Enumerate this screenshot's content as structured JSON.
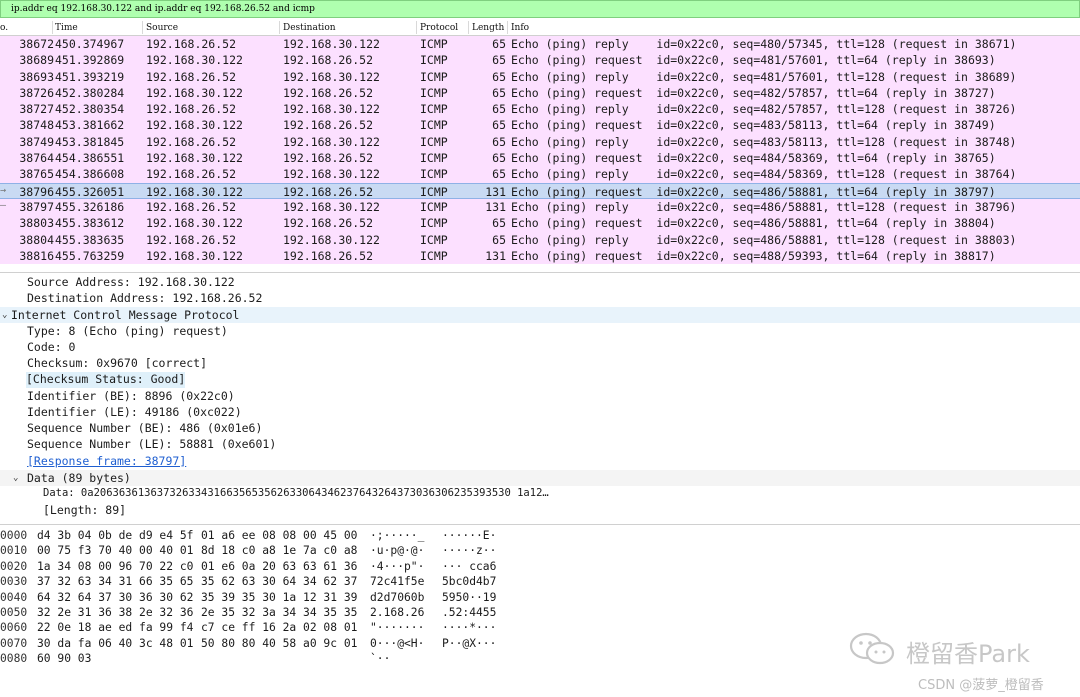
{
  "filter": {
    "text": "ip.addr eq 192.168.30.122 and ip.addr eq 192.168.26.52 and icmp"
  },
  "columns": [
    "o.",
    "Time",
    "Source",
    "Destination",
    "Protocol",
    "Length",
    "Info"
  ],
  "packets": [
    {
      "mark": "",
      "no": "38672",
      "time": "450.374967",
      "src": "192.168.26.52",
      "dst": "192.168.30.122",
      "proto": "ICMP",
      "len": "65",
      "info": "Echo (ping) reply    id=0x22c0, seq=480/57345, ttl=128 (request in 38671)",
      "selected": false
    },
    {
      "mark": "",
      "no": "38689",
      "time": "451.392869",
      "src": "192.168.30.122",
      "dst": "192.168.26.52",
      "proto": "ICMP",
      "len": "65",
      "info": "Echo (ping) request  id=0x22c0, seq=481/57601, ttl=64 (reply in 38693)",
      "selected": false
    },
    {
      "mark": "",
      "no": "38693",
      "time": "451.393219",
      "src": "192.168.26.52",
      "dst": "192.168.30.122",
      "proto": "ICMP",
      "len": "65",
      "info": "Echo (ping) reply    id=0x22c0, seq=481/57601, ttl=128 (request in 38689)",
      "selected": false
    },
    {
      "mark": "",
      "no": "38726",
      "time": "452.380284",
      "src": "192.168.30.122",
      "dst": "192.168.26.52",
      "proto": "ICMP",
      "len": "65",
      "info": "Echo (ping) request  id=0x22c0, seq=482/57857, ttl=64 (reply in 38727)",
      "selected": false
    },
    {
      "mark": "",
      "no": "38727",
      "time": "452.380354",
      "src": "192.168.26.52",
      "dst": "192.168.30.122",
      "proto": "ICMP",
      "len": "65",
      "info": "Echo (ping) reply    id=0x22c0, seq=482/57857, ttl=128 (request in 38726)",
      "selected": false
    },
    {
      "mark": "",
      "no": "38748",
      "time": "453.381662",
      "src": "192.168.30.122",
      "dst": "192.168.26.52",
      "proto": "ICMP",
      "len": "65",
      "info": "Echo (ping) request  id=0x22c0, seq=483/58113, ttl=64 (reply in 38749)",
      "selected": false
    },
    {
      "mark": "",
      "no": "38749",
      "time": "453.381845",
      "src": "192.168.26.52",
      "dst": "192.168.30.122",
      "proto": "ICMP",
      "len": "65",
      "info": "Echo (ping) reply    id=0x22c0, seq=483/58113, ttl=128 (request in 38748)",
      "selected": false
    },
    {
      "mark": "",
      "no": "38764",
      "time": "454.386551",
      "src": "192.168.30.122",
      "dst": "192.168.26.52",
      "proto": "ICMP",
      "len": "65",
      "info": "Echo (ping) request  id=0x22c0, seq=484/58369, ttl=64 (reply in 38765)",
      "selected": false
    },
    {
      "mark": "",
      "no": "38765",
      "time": "454.386608",
      "src": "192.168.26.52",
      "dst": "192.168.30.122",
      "proto": "ICMP",
      "len": "65",
      "info": "Echo (ping) reply    id=0x22c0, seq=484/58369, ttl=128 (request in 38764)",
      "selected": false
    },
    {
      "mark": "→",
      "no": "38796",
      "time": "455.326051",
      "src": "192.168.30.122",
      "dst": "192.168.26.52",
      "proto": "ICMP",
      "len": "131",
      "info": "Echo (ping) request  id=0x22c0, seq=486/58881, ttl=64 (reply in 38797)",
      "selected": true
    },
    {
      "mark": "—",
      "no": "38797",
      "time": "455.326186",
      "src": "192.168.26.52",
      "dst": "192.168.30.122",
      "proto": "ICMP",
      "len": "131",
      "info": "Echo (ping) reply    id=0x22c0, seq=486/58881, ttl=128 (request in 38796)",
      "selected": false
    },
    {
      "mark": "",
      "no": "38803",
      "time": "455.383612",
      "src": "192.168.30.122",
      "dst": "192.168.26.52",
      "proto": "ICMP",
      "len": "65",
      "info": "Echo (ping) request  id=0x22c0, seq=486/58881, ttl=64 (reply in 38804)",
      "selected": false
    },
    {
      "mark": "",
      "no": "38804",
      "time": "455.383635",
      "src": "192.168.26.52",
      "dst": "192.168.30.122",
      "proto": "ICMP",
      "len": "65",
      "info": "Echo (ping) reply    id=0x22c0, seq=486/58881, ttl=128 (request in 38803)",
      "selected": false
    },
    {
      "mark": "",
      "no": "38816",
      "time": "455.763259",
      "src": "192.168.30.122",
      "dst": "192.168.26.52",
      "proto": "ICMP",
      "len": "131",
      "info": "Echo (ping) request  id=0x22c0, seq=488/59393, ttl=64 (reply in 38817)",
      "selected": false
    }
  ],
  "details": {
    "src_addr": "Source Address: 192.168.30.122",
    "dst_addr": "Destination Address: 192.168.26.52",
    "icmp_title": "Internet Control Message Protocol",
    "type": "Type: 8 (Echo (ping) request)",
    "code": "Code: 0",
    "checksum": "Checksum: 0x9670 [correct]",
    "checksum_status": "[Checksum Status: Good]",
    "id_be": "Identifier (BE): 8896 (0x22c0)",
    "id_le": "Identifier (LE): 49186 (0xc022)",
    "seq_be": "Sequence Number (BE): 486 (0x01e6)",
    "seq_le": "Sequence Number (LE): 58881 (0xe601)",
    "response_frame": "[Response frame: 38797]",
    "data_title": "Data (89 bytes)",
    "data_value": "Data: 0a206363613637326334316635653562633064346237643264373036306235393530 1a12…",
    "data_length": "[Length: 89]"
  },
  "bytes": [
    {
      "off": "0000",
      "hex1": "d4 3b 04 0b de d9 e4 5f",
      "hex2": "01 a6 ee 08 08 00 45 00",
      "asc1": "·;·····_",
      "asc2": "······E·"
    },
    {
      "off": "0010",
      "hex1": "00 75 f3 70 40 00 40 01",
      "hex2": "8d 18 c0 a8 1e 7a c0 a8",
      "asc1": "·u·p@·@·",
      "asc2": "·····z··"
    },
    {
      "off": "0020",
      "hex1": "1a 34 08 00 96 70 22 c0",
      "hex2": "01 e6 0a 20 63 63 61 36",
      "asc1": "·4···p\"·",
      "asc2": "··· cca6"
    },
    {
      "off": "0030",
      "hex1": "37 32 63 34 31 66 35 65",
      "hex2": "35 62 63 30 64 34 62 37",
      "asc1": "72c41f5e",
      "asc2": "5bc0d4b7"
    },
    {
      "off": "0040",
      "hex1": "64 32 64 37 30 36 30 62",
      "hex2": "35 39 35 30 1a 12 31 39",
      "asc1": "d2d7060b",
      "asc2": "5950··19"
    },
    {
      "off": "0050",
      "hex1": "32 2e 31 36 38 2e 32 36",
      "hex2": "2e 35 32 3a 34 34 35 35",
      "asc1": "2.168.26",
      "asc2": ".52:4455"
    },
    {
      "off": "0060",
      "hex1": "22 0e 18 ae ed fa 99 f4",
      "hex2": "c7 ce ff 16 2a 02 08 01",
      "asc1": "\"·······",
      "asc2": "····*···"
    },
    {
      "off": "0070",
      "hex1": "30 da fa 06 40 3c 48 01",
      "hex2": "50 80 80 40 58 a0 9c 01",
      "asc1": "0···@<H·",
      "asc2": "P··@X···"
    },
    {
      "off": "0080",
      "hex1": "60 90 03",
      "hex2": "",
      "asc1": "`··",
      "asc2": ""
    }
  ],
  "watermark": {
    "brand": "橙留香Park",
    "csdn": "CSDN @菠萝_橙留香"
  },
  "colors": {
    "filter_bg": "#afffaf",
    "icmp_row": "#fce0ff",
    "selected_row": "#c9daf3",
    "link": "#1f5fd1"
  }
}
